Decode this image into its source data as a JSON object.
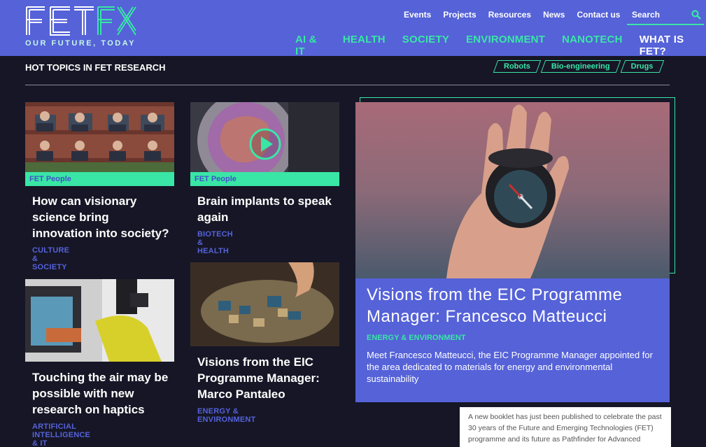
{
  "header": {
    "logo_text": "FETFX",
    "tagline": "OUR FUTURE, TODAY",
    "top_nav": [
      "Events",
      "Projects",
      "Resources",
      "News",
      "Contact us"
    ],
    "search_placeholder": "Search",
    "main_nav": [
      "AI & IT",
      "HEALTH",
      "SOCIETY",
      "ENVIRONMENT",
      "NANOTECH",
      "WHAT IS FET?"
    ]
  },
  "hot_topics": {
    "title": "HOT TOPICS IN FET RESEARCH",
    "tags": [
      "Robots",
      "Bio-engineering",
      "Drugs"
    ]
  },
  "cards": [
    {
      "label": "FET People",
      "title": "How can visionary science bring innovation into society?",
      "category": "CULTURE & SOCIETY"
    },
    {
      "label": "FET People",
      "title": "Brain implants to speak again",
      "category": "BIOTECH & HEALTH"
    },
    {
      "label": "",
      "title": "Touching the air may be possible with new research on haptics",
      "category": "ARTIFICIAL INTELLIGENCE & IT"
    },
    {
      "label": "",
      "title": "Visions from the EIC Programme Manager: Marco Pantaleo",
      "category": "ENERGY & ENVIRONMENT"
    }
  ],
  "feature": {
    "title": "Visions from the EIC Programme Manager: Francesco Matteucci",
    "category": "ENERGY & ENVIRONMENT",
    "description": "Meet Francesco Matteucci, the EIC Programme Manager appointed for the area dedicated to materials for energy and environmental sustainability"
  },
  "booklet_text": "A new booklet has just been published to celebrate the past 30 years of the Future and Emerging Technologies (FET) programme and its future as Pathfinder for Advanced",
  "colors": {
    "brand": "#5562d8",
    "accent": "#39e6a6",
    "background": "#161626"
  },
  "icons": [
    "search-icon",
    "play-icon"
  ]
}
